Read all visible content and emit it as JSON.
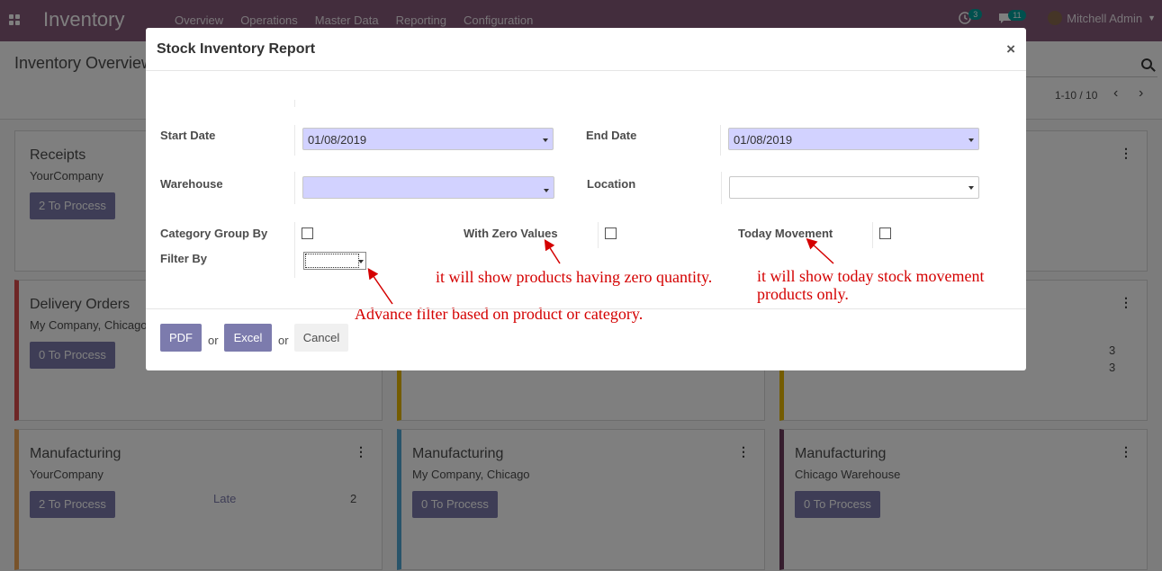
{
  "navbar": {
    "app_title": "Inventory",
    "menu": [
      "Overview",
      "Operations",
      "Master Data",
      "Reporting",
      "Configuration"
    ],
    "activity_count": "3",
    "message_count": "11",
    "user": "Mitchell Admin"
  },
  "control_panel": {
    "breadcrumb": "Inventory Overview",
    "pager": "1-10 / 10"
  },
  "cards": [
    {
      "title": "Receipts",
      "subtitle": "YourCompany",
      "button": "2 To Process"
    },
    {
      "title": "Delivery Orders",
      "subtitle": "My Company, Chicago",
      "button": "0 To Process",
      "stripe": "#dc4d4d"
    },
    {
      "title": "Manufacturing",
      "subtitle": "YourCompany",
      "button": "2 To Process",
      "stat_label": "Late",
      "stat_value": "2",
      "stripe": "#f0a756"
    },
    {
      "title": "Manufacturing",
      "subtitle": "My Company, Chicago",
      "button": "0 To Process",
      "stripe": "#52a9d5"
    },
    {
      "title": "Manufacturing",
      "subtitle": "Chicago Warehouse",
      "button": "0 To Process",
      "stripe": "#6c3a5c"
    },
    {
      "stat_value_1": "3",
      "stat_value_2": "3"
    }
  ],
  "modal": {
    "title": "Stock Inventory Report",
    "start_date_label": "Start Date",
    "start_date": "01/08/2019",
    "end_date_label": "End Date",
    "end_date": "01/08/2019",
    "warehouse_label": "Warehouse",
    "location_label": "Location",
    "category_group_label": "Category Group By",
    "zero_values_label": "With Zero Values",
    "today_movement_label": "Today Movement",
    "filter_by_label": "Filter By",
    "note_zero": "it will show products having zero quantity.",
    "note_today_1": "it will show today stock movement",
    "note_today_2": "products only.",
    "note_filter": "Advance filter based on product or category.",
    "pdf": "PDF",
    "or": "or",
    "excel": "Excel",
    "cancel": "Cancel"
  },
  "colors": {
    "navbar": "#875a7b",
    "primary_button": "#7c7bad",
    "required_field": "#d2d2ff",
    "annotation": "#d40000"
  }
}
